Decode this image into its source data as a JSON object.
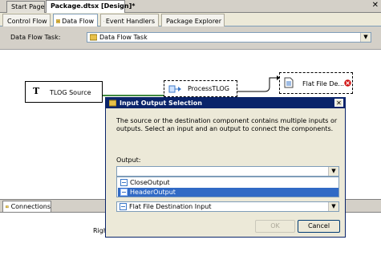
{
  "doc_tabs": [
    {
      "label": "Start Page"
    },
    {
      "label": "Package.dtsx [Design]*"
    }
  ],
  "designer_tabs": [
    {
      "label": "Control Flow"
    },
    {
      "label": "Data Flow"
    },
    {
      "label": "Event Handlers"
    },
    {
      "label": "Package Explorer"
    }
  ],
  "task_row": {
    "label": "Data Flow Task:",
    "selected": "Data Flow Task"
  },
  "components": {
    "source": "TLOG Source",
    "transform": "ProcessTLOG",
    "destination": "Flat File De..."
  },
  "connections_tab": "Connections",
  "connections_text": "Right",
  "dialog": {
    "title": "Input Output Selection",
    "description": "The source or the destination component contains multiple inputs or outputs. Select an input and an output to connect the components.",
    "output_label": "Output:",
    "output_value": "",
    "options": [
      "CloseOutput",
      "HeaderOutput"
    ],
    "selected_index": 1,
    "input_value": "Flat File Destination Input",
    "ok": "OK",
    "cancel": "Cancel"
  }
}
